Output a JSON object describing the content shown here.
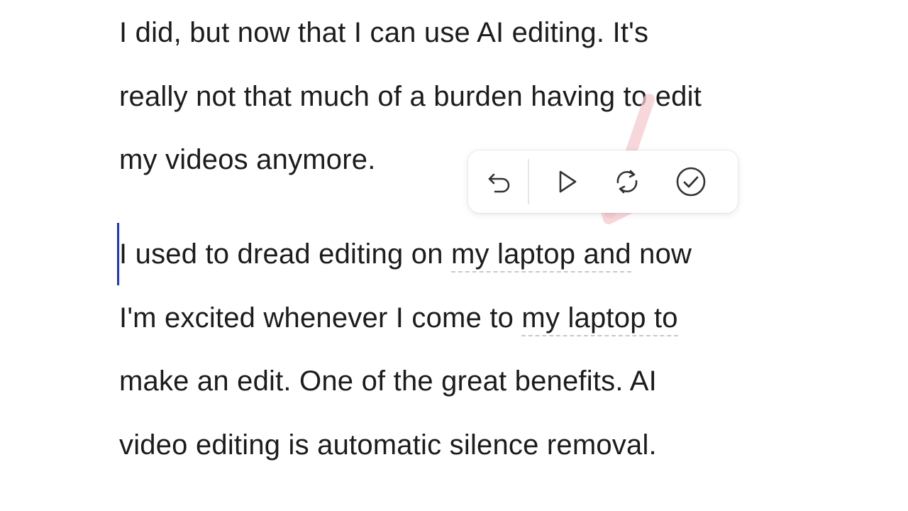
{
  "document": {
    "paragraph1": {
      "line1": "I did, but now that I can use AI editing. It's",
      "line2": "really not that much of a burden having to edit",
      "line3": "my videos anymore."
    },
    "paragraph2": {
      "line1_a": "I used to dread editing on ",
      "line1_flag": "my laptop and",
      "line1_b": " now",
      "line2_a": "I'm excited whenever I come to ",
      "line2_flag": "my laptop to",
      "line3": "make an edit. One of the great benefits. AI",
      "line4": "video editing is automatic silence removal."
    }
  },
  "toolbar": {
    "buttons": [
      {
        "icon": "undo-icon"
      },
      {
        "icon": "play-icon"
      },
      {
        "icon": "regenerate-icon"
      },
      {
        "icon": "accept-check-icon"
      }
    ]
  },
  "colors": {
    "caret": "#2233d8",
    "text": "#1c1c1c",
    "arrow_overlay": "#f6c9cf"
  }
}
